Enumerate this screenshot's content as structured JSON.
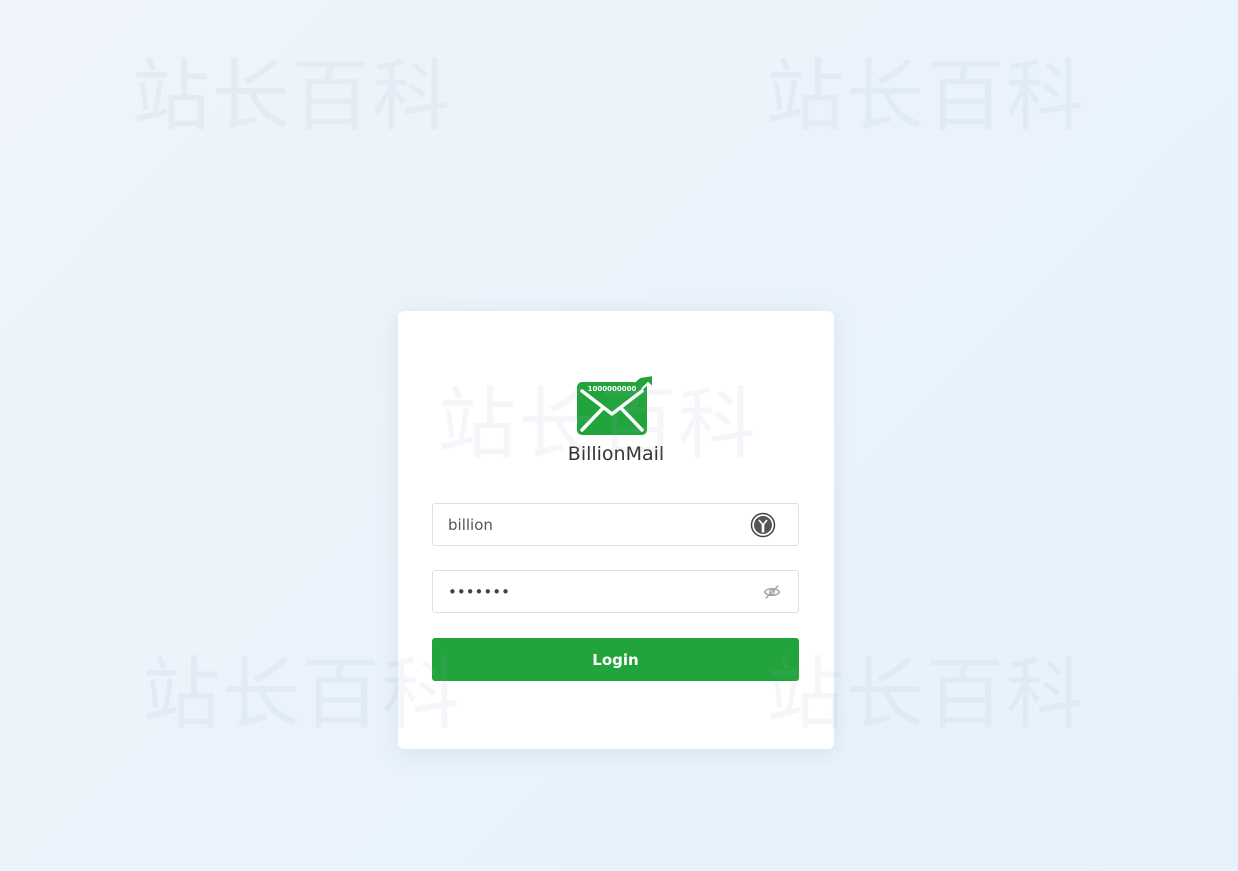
{
  "app": {
    "brand_name": "BillionMail",
    "logo_text": "1000000000",
    "accent_color": "#22a43c"
  },
  "watermark": {
    "text": "站长百科"
  },
  "login": {
    "username_value": "billion",
    "password_value": "•••••••",
    "username_icon": "password-manager-icon",
    "password_icon": "eye-slash-icon",
    "button_label": "Login"
  }
}
